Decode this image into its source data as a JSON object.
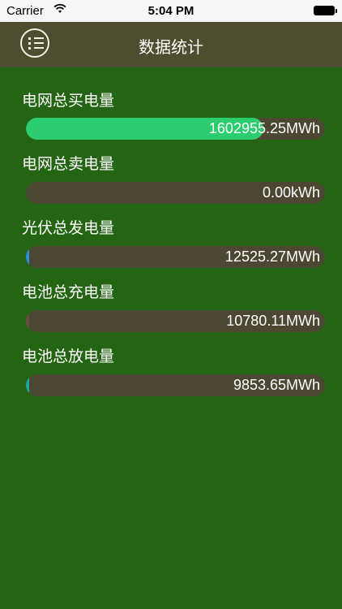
{
  "status_bar": {
    "carrier": "Carrier",
    "time": "5:04 PM"
  },
  "navbar": {
    "title": "数据统计",
    "menu_icon": "list-icon"
  },
  "stats": [
    {
      "label": "电网总买电量",
      "value_text": "1602955.25MWh",
      "fill_fraction": 0.795,
      "fill_color": "#2bcd6e"
    },
    {
      "label": "电网总卖电量",
      "value_text": "0.00kWh",
      "fill_fraction": 0.0,
      "fill_color": "#2bcd6e"
    },
    {
      "label": "光伏总发电量",
      "value_text": "12525.27MWh",
      "fill_fraction": 0.006,
      "fill_color": "#2a8fd6"
    },
    {
      "label": "电池总充电量",
      "value_text": "10780.11MWh",
      "fill_fraction": 0.005,
      "fill_color": "#6a4a3c"
    },
    {
      "label": "电池总放电量",
      "value_text": "9853.65MWh",
      "fill_fraction": 0.005,
      "fill_color": "#1ba6a0"
    }
  ],
  "colors": {
    "background": "#236512",
    "navbar": "#4e4d30",
    "track": "#4b4732"
  }
}
